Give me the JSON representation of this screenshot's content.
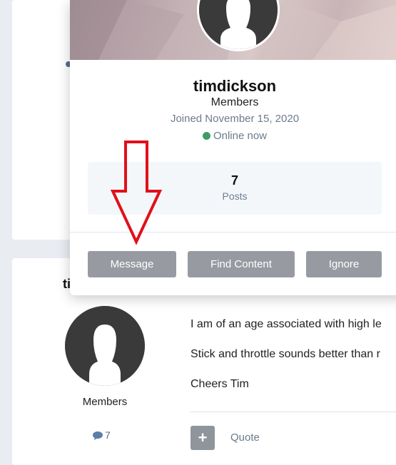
{
  "hovercard": {
    "username": "timdickson",
    "group": "Members",
    "joined": "Joined November 15, 2020",
    "status": "Online now",
    "stats": [
      {
        "value": "7",
        "label": "Posts"
      }
    ],
    "buttons": {
      "message": "Message",
      "find_content": "Find Content",
      "ignore": "Ignore"
    }
  },
  "post": {
    "author_fragment": "ti",
    "author_group": "Members",
    "post_count": "7",
    "lines": [
      "I am of an age associated with high le",
      "Stick and throttle sounds better than r",
      "Cheers Tim"
    ],
    "quote_label": "Quote",
    "add_label": "+"
  },
  "colors": {
    "online": "#3f9d63",
    "button": "#979ba1",
    "annotation_arrow": "#e0101a"
  },
  "icons": [
    "avatar-silhouette-icon",
    "comment-icon",
    "plus-icon",
    "online-dot-icon",
    "down-arrow-annotation"
  ]
}
